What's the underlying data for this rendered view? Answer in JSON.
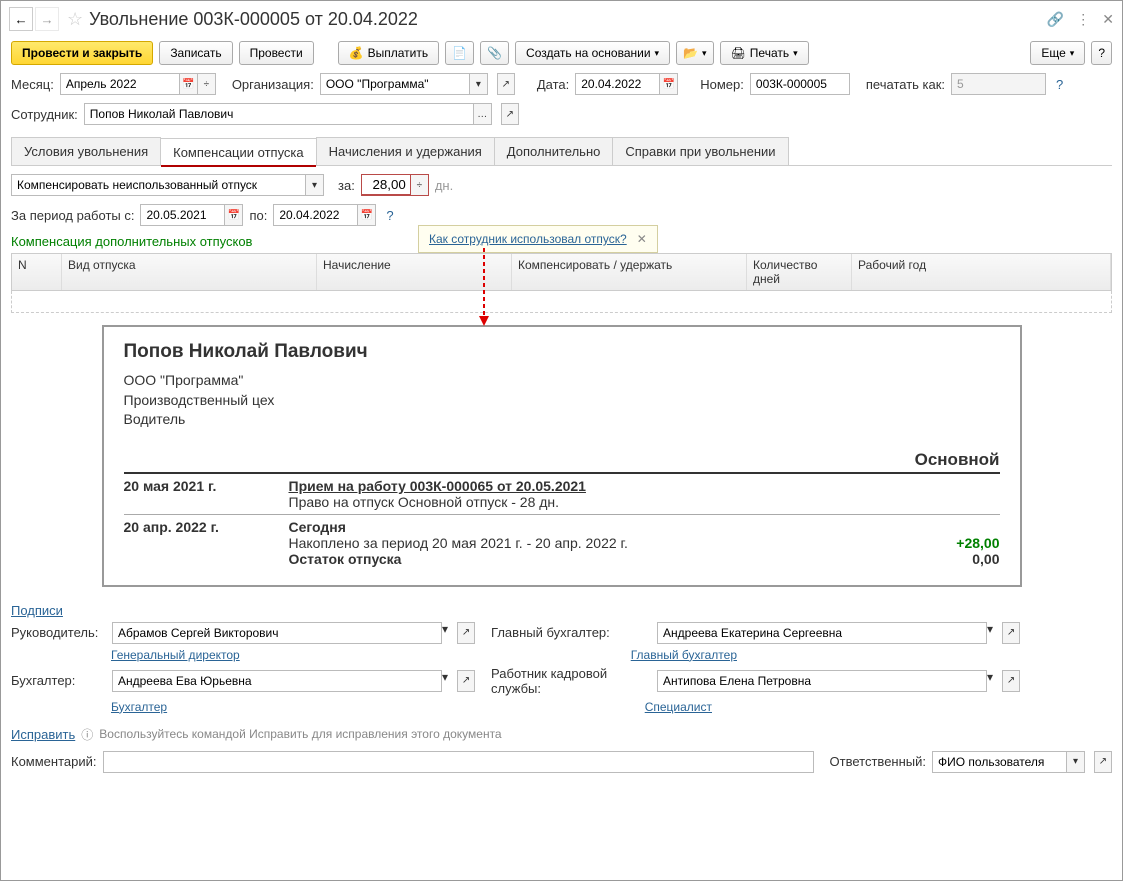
{
  "title": "Увольнение 003К-000005 от 20.04.2022",
  "toolbar": {
    "post_close": "Провести и закрыть",
    "save": "Записать",
    "post": "Провести",
    "payout": "Выплатить",
    "create_based": "Создать на основании",
    "print": "Печать",
    "more": "Еще"
  },
  "header": {
    "month_label": "Месяц:",
    "month": "Апрель 2022",
    "org_label": "Организация:",
    "org": "ООО \"Программа\"",
    "date_label": "Дата:",
    "date": "20.04.2022",
    "number_label": "Номер:",
    "number": "003К-000005",
    "print_as_label": "печатать как:",
    "print_as": "5",
    "employee_label": "Сотрудник:",
    "employee": "Попов Николай Павлович"
  },
  "tabs": {
    "t1": "Условия увольнения",
    "t2": "Компенсации отпуска",
    "t3": "Начисления и удержания",
    "t4": "Дополнительно",
    "t5": "Справки при увольнении"
  },
  "comp": {
    "mode": "Компенсировать неиспользованный отпуск",
    "for_label": "за:",
    "days": "28,00",
    "days_unit": "дн.",
    "period_label": "За период работы с:",
    "from": "20.05.2021",
    "to_label": "по:",
    "to": "20.04.2022",
    "extra_label": "Компенсация дополнительных отпусков"
  },
  "tooltip": {
    "text": "Как сотрудник использовал отпуск?"
  },
  "grid": {
    "n": "N",
    "type": "Вид отпуска",
    "calc": "Начисление",
    "comp": "Компенсировать / удержать",
    "days": "Количество дней",
    "year": "Рабочий год"
  },
  "report": {
    "name": "Попов Николай Павлович",
    "org": "ООО \"Программа\"",
    "dept": "Производственный цех",
    "position": "Водитель",
    "section": "Основной",
    "r1_date": "20 мая 2021 г.",
    "r1_event": "Прием на работу 003К-000065 от 20.05.2021",
    "r1_note": "Право на отпуск Основной отпуск - 28 дн.",
    "r2_date": "20 апр. 2022 г.",
    "r2_event": "Сегодня",
    "r2_note": "Накоплено за период 20 мая 2021 г. - 20 апр. 2022 г.",
    "r2_val": "+28,00",
    "r3_label": "Остаток отпуска",
    "r3_val": "0,00"
  },
  "signatures": {
    "heading": "Подписи",
    "manager_label": "Руководитель:",
    "manager": "Абрамов Сергей Викторович",
    "manager_pos": "Генеральный директор",
    "chief_acc_label": "Главный бухгалтер:",
    "chief_acc": "Андреева Екатерина Сергеевна",
    "chief_acc_pos": "Главный бухгалтер",
    "acc_label": "Бухгалтер:",
    "acc": "Андреева Ева Юрьевна",
    "acc_pos": "Бухгалтер",
    "hr_label": "Работник кадровой службы:",
    "hr": "Антипова Елена Петровна",
    "hr_pos": "Специалист"
  },
  "footer": {
    "fix": "Исправить",
    "fix_note": "Воспользуйтесь командой Исправить для исправления этого документа",
    "comment_label": "Комментарий:",
    "responsible_label": "Ответственный:",
    "responsible": "ФИО пользователя"
  }
}
